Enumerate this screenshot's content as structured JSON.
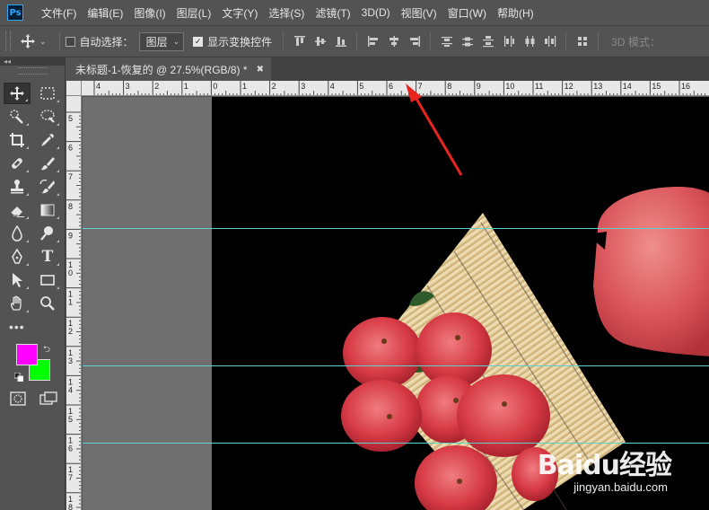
{
  "app": {
    "logo_text": "Ps"
  },
  "menu": [
    "文件(F)",
    "编辑(E)",
    "图像(I)",
    "图层(L)",
    "文字(Y)",
    "选择(S)",
    "滤镜(T)",
    "3D(D)",
    "视图(V)",
    "窗口(W)",
    "帮助(H)"
  ],
  "options": {
    "auto_select_label": "自动选择：",
    "auto_select_checked": false,
    "target_value": "图层",
    "show_transform_label": "显示变换控件",
    "show_transform_checked": true,
    "mode_3d_label": "3D 模式："
  },
  "document": {
    "tab_title": "未标题-1-恢复的 @ 27.5%(RGB/8) *"
  },
  "colors": {
    "foreground": "#ff00ff",
    "background": "#00ff00",
    "guide": "#5fd0d0"
  },
  "ruler": {
    "top_labels": [
      "4",
      "3",
      "2",
      "1",
      "0",
      "1",
      "2",
      "3",
      "4",
      "5",
      "6",
      "7",
      "8",
      "9",
      "10",
      "11",
      "12",
      "13",
      "14",
      "15",
      "16"
    ],
    "left_labels": [
      "5",
      "6",
      "7",
      "8",
      "9",
      "10",
      "11",
      "12",
      "13",
      "14",
      "15",
      "16",
      "17",
      "18"
    ]
  },
  "tools": [
    "move-tool",
    "marquee-tool",
    "quick-select-tool",
    "lasso-tool",
    "crop-tool",
    "eyedropper-tool",
    "healing-brush-tool",
    "brush-tool",
    "clone-stamp-tool",
    "history-brush-tool",
    "eraser-tool",
    "gradient-tool",
    "blur-tool",
    "dodge-tool",
    "pen-tool",
    "type-tool",
    "path-select-tool",
    "rectangle-tool",
    "hand-tool",
    "zoom-tool"
  ],
  "type_tool_glyph": "T",
  "more_tools_glyph": "•••",
  "watermark": {
    "main": "Baidu经验",
    "sub": "jingyan.baidu.com"
  }
}
